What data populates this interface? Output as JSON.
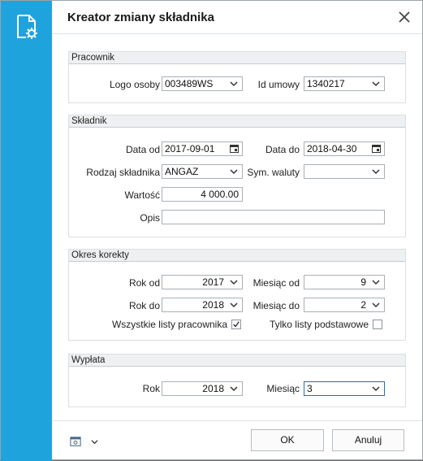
{
  "window": {
    "title": "Kreator zmiany składnika"
  },
  "pracownik": {
    "header": "Pracownik",
    "logo_label": "Logo osoby",
    "logo_value": "003489WS",
    "umowa_label": "Id umowy",
    "umowa_value": "1340217"
  },
  "skladnik": {
    "header": "Składnik",
    "data_od_label": "Data od",
    "data_od_value": "2017-09-01",
    "data_do_label": "Data do",
    "data_do_value": "2018-04-30",
    "rodzaj_label": "Rodzaj składnika",
    "rodzaj_value": "ANGAZ",
    "waluta_label": "Sym. waluty",
    "waluta_value": "",
    "wartosc_label": "Wartość",
    "wartosc_value": "4 000.00",
    "opis_label": "Opis",
    "opis_value": ""
  },
  "okres": {
    "header": "Okres korekty",
    "rok_od_label": "Rok od",
    "rok_od_value": "2017",
    "miesiac_od_label": "Miesiąc od",
    "miesiac_od_value": "9",
    "rok_do_label": "Rok do",
    "rok_do_value": "2018",
    "miesiac_do_label": "Miesiąc do",
    "miesiac_do_value": "2",
    "wszystkie_label": "Wszystkie listy pracownika",
    "wszystkie_checked": true,
    "tylko_label": "Tylko listy podstawowe",
    "tylko_checked": false
  },
  "wyplata": {
    "header": "Wypłata",
    "rok_label": "Rok",
    "rok_value": "2018",
    "miesiac_label": "Miesiąc",
    "miesiac_value": "3"
  },
  "footer": {
    "ok_label": "OK",
    "cancel_label": "Anuluj"
  },
  "colors": {
    "accent": "#1fa3dc",
    "focus": "#1e6fb4"
  },
  "icons": {
    "side": "settings-document-icon",
    "close": "close-icon",
    "tool": "settings-icon"
  }
}
